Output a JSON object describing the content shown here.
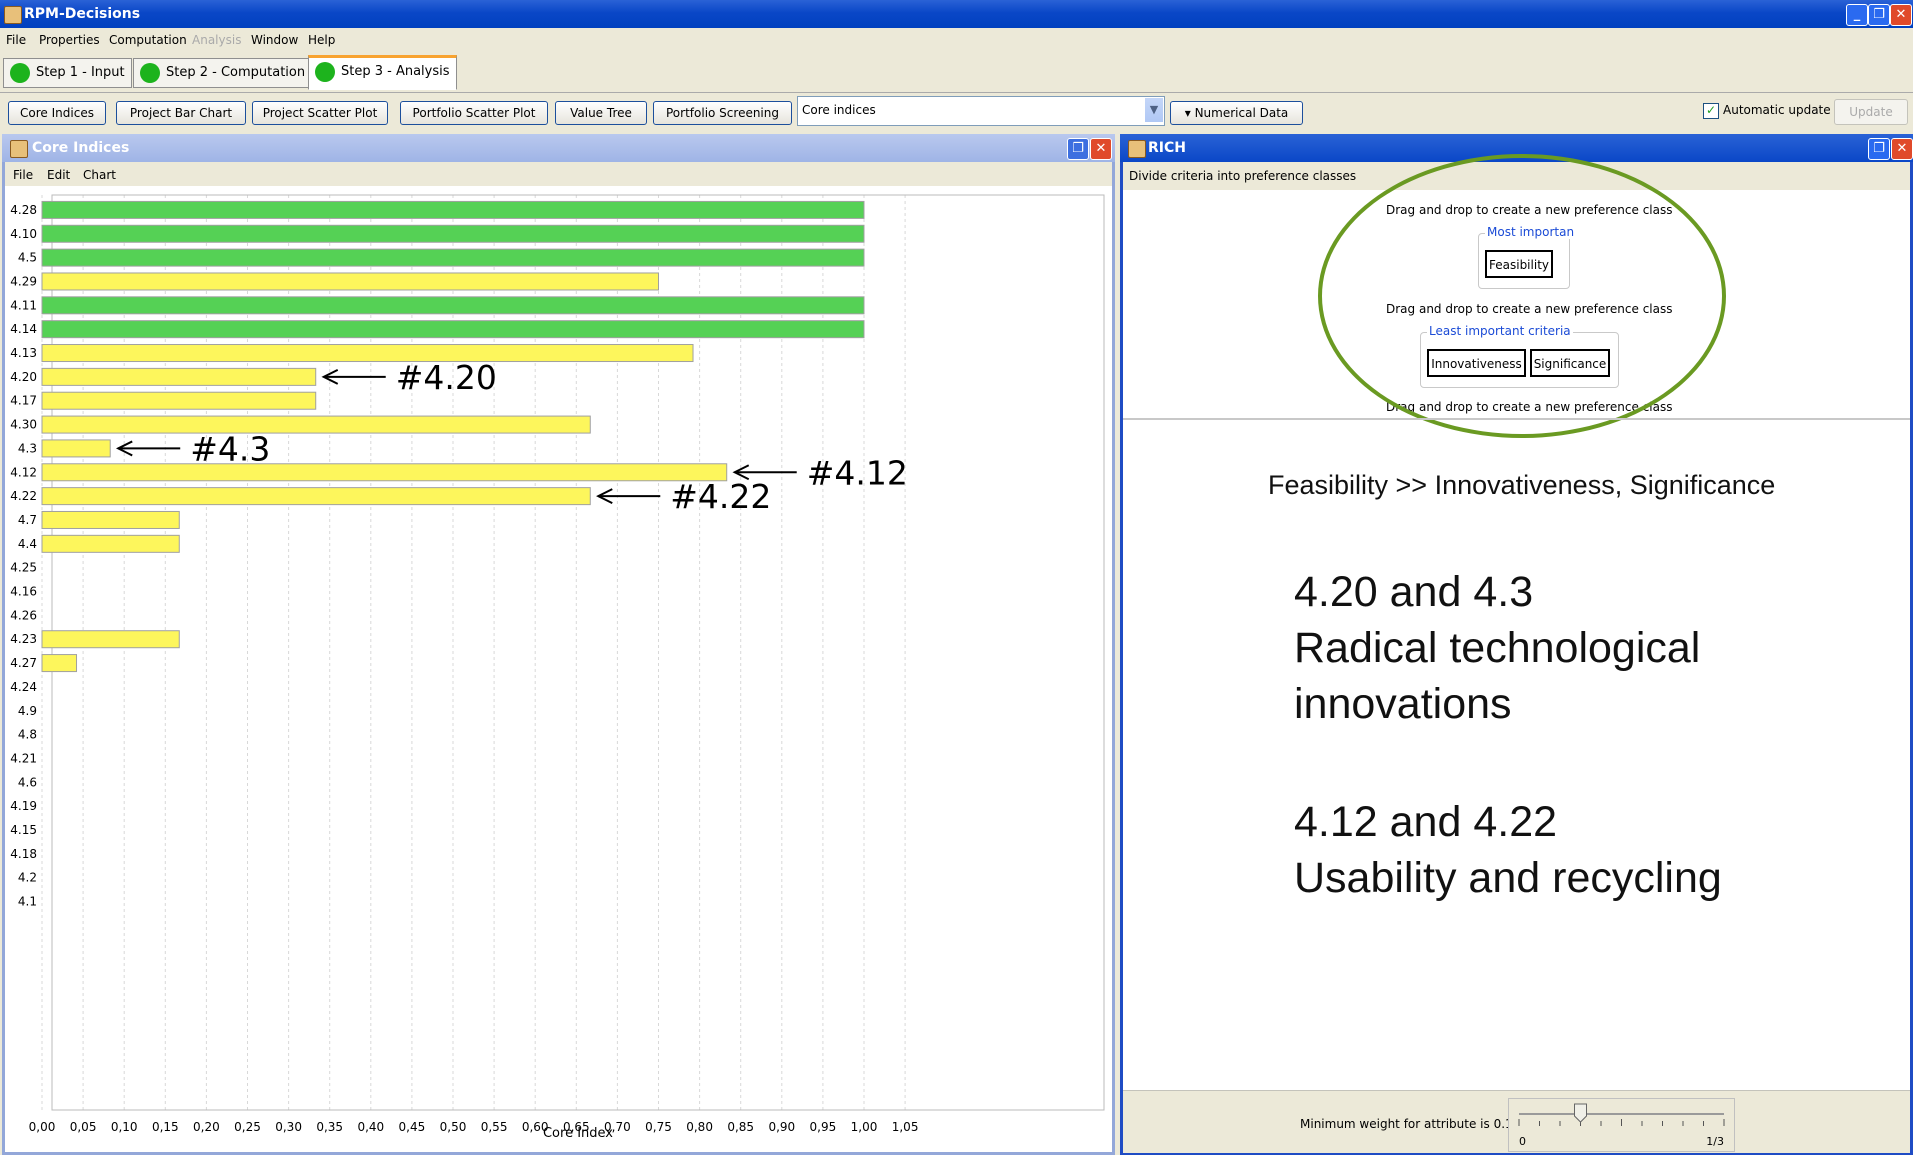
{
  "app": {
    "title": "RPM-Decisions",
    "menu": [
      "File",
      "Properties",
      "Computation",
      "Analysis",
      "Window",
      "Help"
    ],
    "menu_disabled": [
      "Analysis"
    ]
  },
  "steps": [
    {
      "label": "Step 1 - Input",
      "status_color": "#1db31d"
    },
    {
      "label": "Step 2 - Computation",
      "status_color": "#1db31d"
    },
    {
      "label": "Step 3 - Analysis",
      "status_color": "#1db31d",
      "active": true
    }
  ],
  "toolbar": {
    "buttons": [
      "Core Indices",
      "Project Bar Chart",
      "Project Scatter Plot",
      "Portfolio Scatter Plot",
      "Value Tree",
      "Portfolio Screening"
    ],
    "view_select": "Core indices",
    "numerical_data_label": "▾ Numerical Data",
    "automatic_update_label": "Automatic update",
    "automatic_update_checked": true,
    "update_label": "Update"
  },
  "core_indices": {
    "title": "Core Indices",
    "menu": [
      "File",
      "Edit",
      "Chart"
    ]
  },
  "chart_data": {
    "type": "bar",
    "orientation": "horizontal",
    "categories": [
      "4.28",
      "4.10",
      "4.5",
      "4.29",
      "4.11",
      "4.14",
      "4.13",
      "4.20",
      "4.17",
      "4.30",
      "4.3",
      "4.12",
      "4.22",
      "4.7",
      "4.4",
      "4.25",
      "4.16",
      "4.26",
      "4.23",
      "4.27",
      "4.24",
      "4.9",
      "4.8",
      "4.21",
      "4.6",
      "4.19",
      "4.15",
      "4.18",
      "4.2",
      "4.1"
    ],
    "values": [
      1.0,
      1.0,
      1.0,
      0.75,
      1.0,
      1.0,
      0.792,
      0.333,
      0.333,
      0.667,
      0.083,
      0.833,
      0.667,
      0.167,
      0.167,
      0,
      0,
      0,
      0.167,
      0.042,
      0,
      0,
      0,
      0,
      0,
      0,
      0,
      0,
      0,
      0
    ],
    "bar_colors": {
      "core": "#55d155",
      "borderline": "#fdf65c"
    },
    "core_flags": [
      true,
      true,
      true,
      false,
      true,
      true,
      false,
      false,
      false,
      false,
      false,
      false,
      false,
      false,
      false,
      false,
      false,
      false,
      false,
      false,
      false,
      false,
      false,
      false,
      false,
      false,
      false,
      false,
      false,
      false
    ],
    "xlabel": "Core Index",
    "xlim": [
      0,
      1.05
    ],
    "xticks": [
      "0,00",
      "0,05",
      "0,10",
      "0,15",
      "0,20",
      "0,25",
      "0,30",
      "0,35",
      "0,40",
      "0,45",
      "0,50",
      "0,55",
      "0,60",
      "0,65",
      "0,70",
      "0,75",
      "0,80",
      "0,85",
      "0,90",
      "0,95",
      "1,00",
      "1,05"
    ],
    "grid": true,
    "annotations": [
      {
        "text": "#4.20",
        "target": "4.20"
      },
      {
        "text": "#4.3",
        "target": "4.3"
      },
      {
        "text": "#4.12",
        "target": "4.12"
      },
      {
        "text": "#4.22",
        "target": "4.22"
      }
    ]
  },
  "rich": {
    "title": "RICH",
    "subtitle": "Divide criteria into preference classes",
    "drop_hint": "Drag and drop to create a new preference class",
    "classes": [
      {
        "legend": "Most importan",
        "criteria": [
          "Feasibility"
        ]
      },
      {
        "legend": "Least important criteria",
        "criteria": [
          "Innovativeness",
          "Significance"
        ]
      }
    ],
    "ordering": "Feasibility >> Innovativeness, Significance",
    "notes": [
      {
        "heading": "4.20 and 4.3",
        "lines": [
          "Radical technological",
          "innovations"
        ]
      },
      {
        "heading": "4.12 and 4.22",
        "lines": [
          "Usability and recycling"
        ]
      }
    ],
    "min_weight_label": "Minimum weight for attribute is  0.10",
    "slider_min": "0",
    "slider_max": "1/3",
    "slider_value": 0.1
  },
  "colors": {
    "accent_step": "#f8a330",
    "highlight_oval": "#6a9a22",
    "legend_text": "#1b4bd6"
  }
}
